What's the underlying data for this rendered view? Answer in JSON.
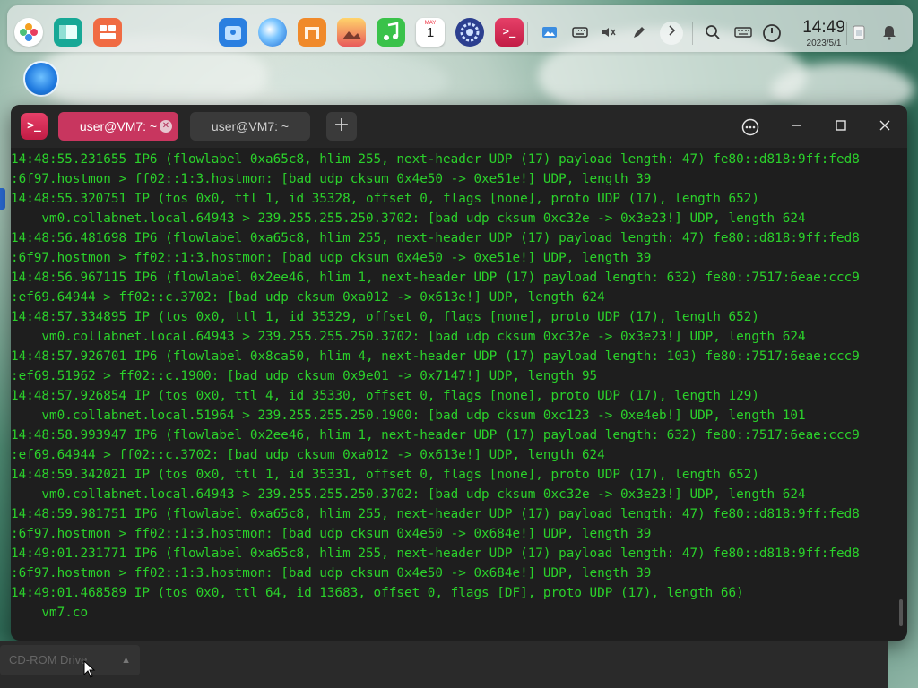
{
  "dock": {
    "apps": [
      {
        "name": "launcher-icon",
        "color": "#ffffff"
      },
      {
        "name": "file-manager-icon",
        "color": "#1fb5a0"
      },
      {
        "name": "control-panel-icon",
        "color": "#f06b43"
      },
      {
        "name": "app-store-icon",
        "color": "#2a7fe0"
      },
      {
        "name": "browser-icon",
        "color": "#2a8df0"
      },
      {
        "name": "shop-icon",
        "color": "#f08a2a"
      },
      {
        "name": "image-viewer-icon",
        "color": "#e85a5a"
      },
      {
        "name": "music-icon",
        "color": "#3ac24a"
      },
      {
        "name": "calendar-icon",
        "color": "#ffffff"
      },
      {
        "name": "settings-icon",
        "color": "#3a5fd0"
      },
      {
        "name": "terminal-icon",
        "color": "#d62a50"
      }
    ],
    "calendar": {
      "month_label": "MAY",
      "day": "1"
    },
    "tray_icons": [
      "screenshot-icon",
      "keyboard-icon",
      "volume-icon",
      "edit-icon",
      "chevron-right-icon",
      "search-icon",
      "input-method-icon",
      "power-icon",
      "trash-icon",
      "notification-icon"
    ],
    "clock": {
      "time": "14:49",
      "date": "2023/5/1"
    }
  },
  "window": {
    "tabs": [
      {
        "label": "user@VM7: ~",
        "active": true
      },
      {
        "label": "user@VM7: ~",
        "active": false
      }
    ],
    "new_tab_label": "+",
    "controls": {
      "menu": "⋯",
      "minimize": "—",
      "maximize": "☐",
      "close": "✕"
    }
  },
  "terminal": {
    "lines": [
      "14:48:55.231655 IP6 (flowlabel 0xa65c8, hlim 255, next-header UDP (17) payload length: 47) fe80::d818:9ff:fed8",
      ":6f97.hostmon > ff02::1:3.hostmon: [bad udp cksum 0x4e50 -> 0xe51e!] UDP, length 39",
      "14:48:55.320751 IP (tos 0x0, ttl 1, id 35328, offset 0, flags [none], proto UDP (17), length 652)",
      "    vm0.collabnet.local.64943 > 239.255.255.250.3702: [bad udp cksum 0xc32e -> 0x3e23!] UDP, length 624",
      "14:48:56.481698 IP6 (flowlabel 0xa65c8, hlim 255, next-header UDP (17) payload length: 47) fe80::d818:9ff:fed8",
      ":6f97.hostmon > ff02::1:3.hostmon: [bad udp cksum 0x4e50 -> 0xe51e!] UDP, length 39",
      "14:48:56.967115 IP6 (flowlabel 0x2ee46, hlim 1, next-header UDP (17) payload length: 632) fe80::7517:6eae:ccc9",
      ":ef69.64944 > ff02::c.3702: [bad udp cksum 0xa012 -> 0x613e!] UDP, length 624",
      "14:48:57.334895 IP (tos 0x0, ttl 1, id 35329, offset 0, flags [none], proto UDP (17), length 652)",
      "    vm0.collabnet.local.64943 > 239.255.255.250.3702: [bad udp cksum 0xc32e -> 0x3e23!] UDP, length 624",
      "14:48:57.926701 IP6 (flowlabel 0x8ca50, hlim 4, next-header UDP (17) payload length: 103) fe80::7517:6eae:ccc9",
      ":ef69.51962 > ff02::c.1900: [bad udp cksum 0x9e01 -> 0x7147!] UDP, length 95",
      "14:48:57.926854 IP (tos 0x0, ttl 4, id 35330, offset 0, flags [none], proto UDP (17), length 129)",
      "    vm0.collabnet.local.51964 > 239.255.255.250.1900: [bad udp cksum 0xc123 -> 0xe4eb!] UDP, length 101",
      "14:48:58.993947 IP6 (flowlabel 0x2ee46, hlim 1, next-header UDP (17) payload length: 632) fe80::7517:6eae:ccc9",
      ":ef69.64944 > ff02::c.3702: [bad udp cksum 0xa012 -> 0x613e!] UDP, length 624",
      "14:48:59.342021 IP (tos 0x0, ttl 1, id 35331, offset 0, flags [none], proto UDP (17), length 652)",
      "    vm0.collabnet.local.64943 > 239.255.255.250.3702: [bad udp cksum 0xc32e -> 0x3e23!] UDP, length 624",
      "14:48:59.981751 IP6 (flowlabel 0xa65c8, hlim 255, next-header UDP (17) payload length: 47) fe80::d818:9ff:fed8",
      ":6f97.hostmon > ff02::1:3.hostmon: [bad udp cksum 0x4e50 -> 0x684e!] UDP, length 39",
      "14:49:01.231771 IP6 (flowlabel 0xa65c8, hlim 255, next-header UDP (17) payload length: 47) fe80::d818:9ff:fed8",
      ":6f97.hostmon > ff02::1:3.hostmon: [bad udp cksum 0x4e50 -> 0x684e!] UDP, length 39",
      "14:49:01.468589 IP (tos 0x0, ttl 64, id 13683, offset 0, flags [DF], proto UDP (17), length 66)",
      "    vm7.co"
    ],
    "text_color": "#2bd12b"
  },
  "desktop": {
    "cdrom_label": "CD-ROM Drive",
    "eject_icon": "▲"
  }
}
